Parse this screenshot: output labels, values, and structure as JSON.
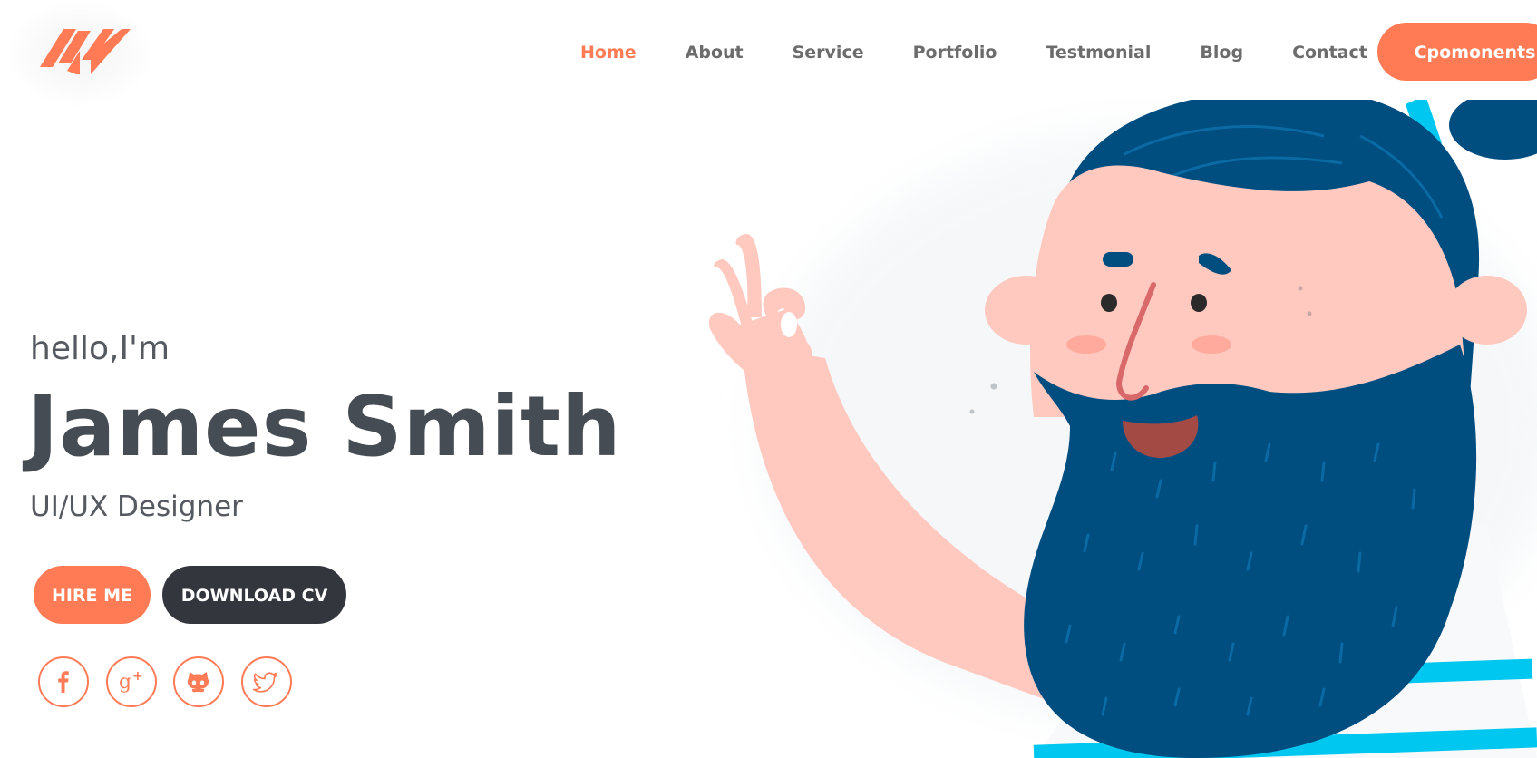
{
  "nav": {
    "items": [
      {
        "label": "Home",
        "active": true
      },
      {
        "label": "About",
        "active": false
      },
      {
        "label": "Service",
        "active": false
      },
      {
        "label": "Portfolio",
        "active": false
      },
      {
        "label": "Testmonial",
        "active": false
      },
      {
        "label": "Blog",
        "active": false
      },
      {
        "label": "Contact",
        "active": false
      }
    ],
    "components_label": "Cpomonents"
  },
  "hero": {
    "greeting": "hello,I'm",
    "name": "James Smith",
    "role": "UI/UX Designer",
    "hire_label": "HIRE ME",
    "download_label": "DOWNLOAD CV"
  },
  "social": [
    {
      "icon": "facebook-icon"
    },
    {
      "icon": "google-plus-icon"
    },
    {
      "icon": "github-icon"
    },
    {
      "icon": "twitter-icon"
    }
  ],
  "colors": {
    "accent": "#ff7b56",
    "dark_button": "#33373d",
    "heading_text": "#464c53",
    "nav_text": "#6c6c6c",
    "beard": "#004d80",
    "skin": "#ffc9c0",
    "shirt_stripe": "#00c7f0"
  }
}
